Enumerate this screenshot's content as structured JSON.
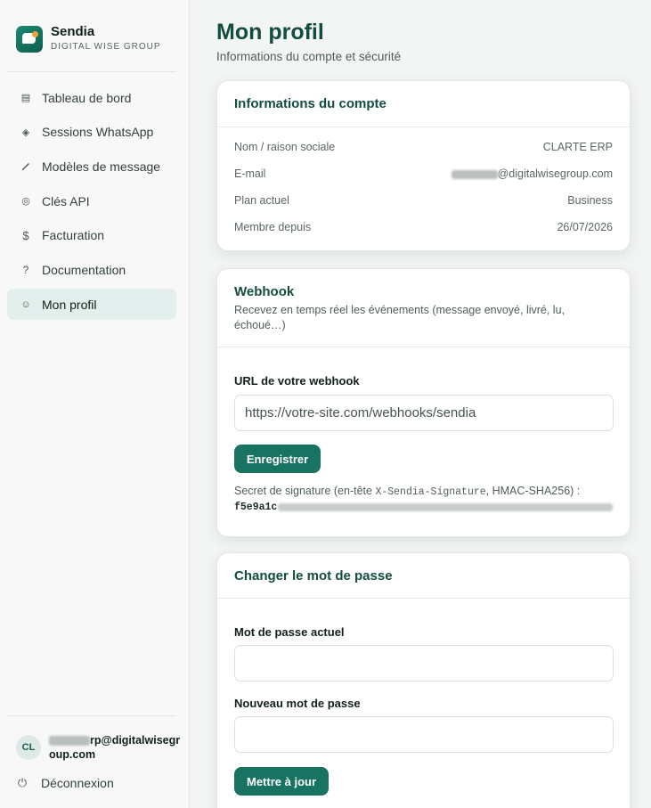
{
  "brand": {
    "name": "Sendia",
    "subtitle": "DIGITAL WISE GROUP"
  },
  "nav": [
    {
      "icon": "dashboard-icon",
      "label": "Tableau de bord"
    },
    {
      "icon": "sessions-icon",
      "label": "Sessions WhatsApp"
    },
    {
      "icon": "pen-icon",
      "label": "Modèles de message"
    },
    {
      "icon": "key-icon",
      "label": "Clés API"
    },
    {
      "icon": "dollar-icon",
      "label": "Facturation"
    },
    {
      "icon": "help-icon",
      "label": "Documentation"
    },
    {
      "icon": "user-icon",
      "label": "Mon profil"
    }
  ],
  "active_nav": "Mon profil",
  "user": {
    "initials": "CL",
    "email_suffix": "rp@digitalwisegroup.com"
  },
  "logout_label": "Déconnexion",
  "page": {
    "title": "Mon profil",
    "subtitle": "Informations du compte et sécurité"
  },
  "account": {
    "title": "Informations du compte",
    "rows": [
      {
        "label": "Nom / raison sociale",
        "value": "CLARTE ERP"
      },
      {
        "label": "E-mail",
        "value": "@digitalwisegroup.com"
      },
      {
        "label": "Plan actuel",
        "value": "Business"
      },
      {
        "label": "Membre depuis",
        "value": "26/07/2026"
      }
    ]
  },
  "webhook": {
    "title": "Webhook",
    "description": "Recevez en temps réel les événements (message envoyé, livré, lu, échoué…)",
    "url_label": "URL de votre webhook",
    "url_placeholder": "https://votre-site.com/webhooks/sendia",
    "save_label": "Enregistrer",
    "secret_prefix": "Secret de signature (en-tête ",
    "secret_header": "X-Sendia-Signature",
    "secret_suffix": ", HMAC-SHA256) :",
    "secret_visible": "f5e9a1c"
  },
  "password": {
    "title": "Changer le mot de passe",
    "current_label": "Mot de passe actuel",
    "new_label": "Nouveau mot de passe",
    "submit_label": "Mettre à jour"
  }
}
